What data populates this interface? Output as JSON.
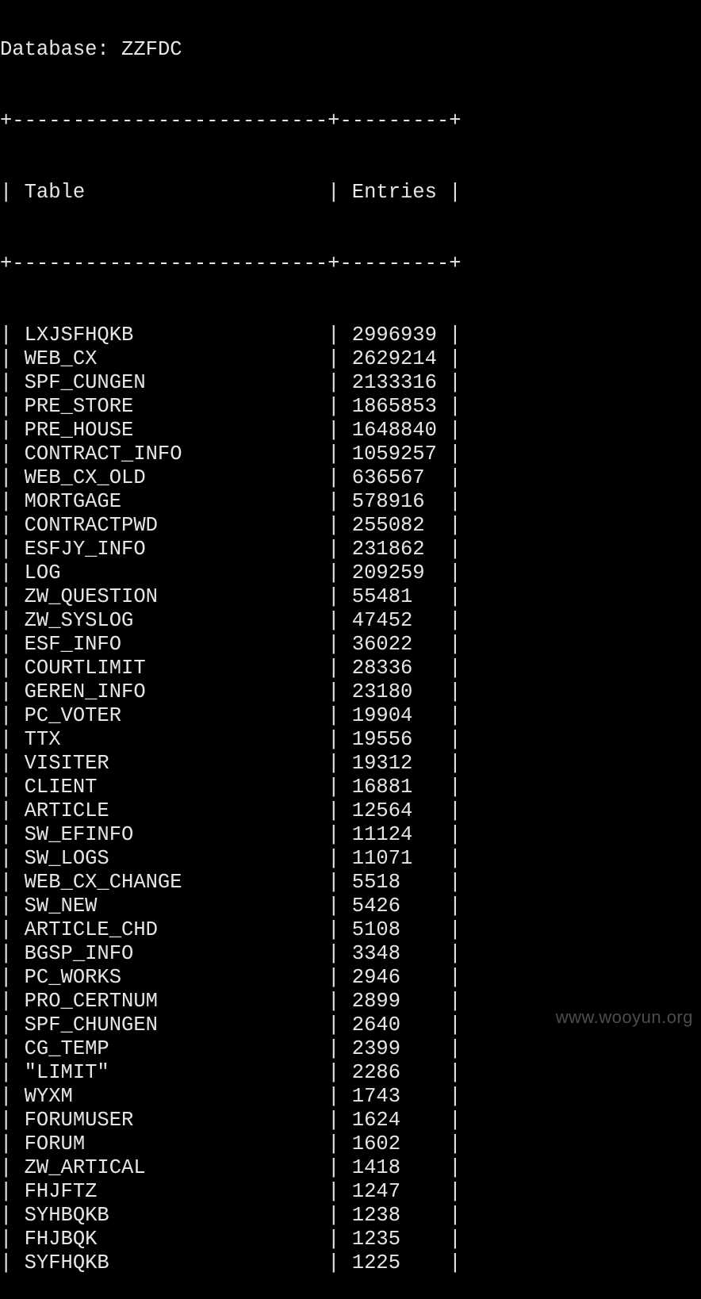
{
  "header": {
    "database_label": "Database:",
    "database_name": "ZZFDC"
  },
  "table": {
    "columns": [
      "Table",
      "Entries"
    ],
    "rows": [
      [
        "LXJSFHQKB",
        "2996939"
      ],
      [
        "WEB_CX",
        "2629214"
      ],
      [
        "SPF_CUNGEN",
        "2133316"
      ],
      [
        "PRE_STORE",
        "1865853"
      ],
      [
        "PRE_HOUSE",
        "1648840"
      ],
      [
        "CONTRACT_INFO",
        "1059257"
      ],
      [
        "WEB_CX_OLD",
        "636567"
      ],
      [
        "MORTGAGE",
        "578916"
      ],
      [
        "CONTRACTPWD",
        "255082"
      ],
      [
        "ESFJY_INFO",
        "231862"
      ],
      [
        "LOG",
        "209259"
      ],
      [
        "ZW_QUESTION",
        "55481"
      ],
      [
        "ZW_SYSLOG",
        "47452"
      ],
      [
        "ESF_INFO",
        "36022"
      ],
      [
        "COURTLIMIT",
        "28336"
      ],
      [
        "GEREN_INFO",
        "23180"
      ],
      [
        "PC_VOTER",
        "19904"
      ],
      [
        "TTX",
        "19556"
      ],
      [
        "VISITER",
        "19312"
      ],
      [
        "CLIENT",
        "16881"
      ],
      [
        "ARTICLE",
        "12564"
      ],
      [
        "SW_EFINFO",
        "11124"
      ],
      [
        "SW_LOGS",
        "11071"
      ],
      [
        "WEB_CX_CHANGE",
        "5518"
      ],
      [
        "SW_NEW",
        "5426"
      ],
      [
        "ARTICLE_CHD",
        "5108"
      ],
      [
        "BGSP_INFO",
        "3348"
      ],
      [
        "PC_WORKS",
        "2946"
      ],
      [
        "PRO_CERTNUM",
        "2899"
      ],
      [
        "SPF_CHUNGEN",
        "2640"
      ],
      [
        "CG_TEMP",
        "2399"
      ],
      [
        "\"LIMIT\"",
        "2286"
      ],
      [
        "WYXM",
        "1743"
      ],
      [
        "FORUMUSER",
        "1624"
      ],
      [
        "FORUM",
        "1602"
      ],
      [
        "ZW_ARTICAL",
        "1418"
      ],
      [
        "FHJFTZ",
        "1247"
      ],
      [
        "SYHBQKB",
        "1238"
      ],
      [
        "FHJBQK",
        "1235"
      ],
      [
        "SYFHQKB",
        "1225"
      ]
    ]
  },
  "watermark": "www.wooyun.org",
  "colors": {
    "background": "#000000",
    "text": "#e6e6e6",
    "watermark": "#8a8a8a"
  }
}
